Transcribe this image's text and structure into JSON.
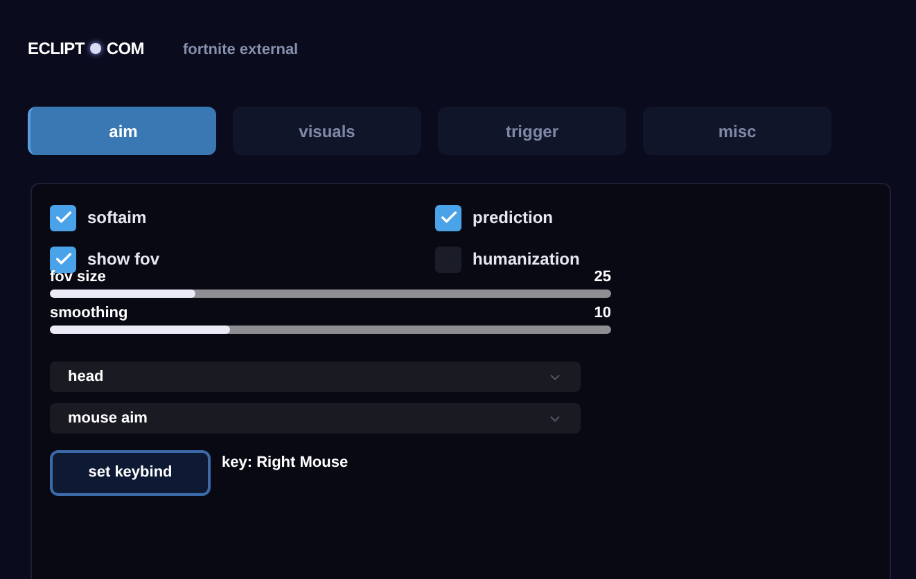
{
  "brand": {
    "left": "ECLIPT",
    "right": "COM"
  },
  "subtitle": "fortnite external",
  "tabs": [
    {
      "label": "aim",
      "selected": true
    },
    {
      "label": "visuals",
      "selected": false
    },
    {
      "label": "trigger",
      "selected": false
    },
    {
      "label": "misc",
      "selected": false
    }
  ],
  "checkboxes": [
    {
      "label": "softaim",
      "checked": true
    },
    {
      "label": "prediction",
      "checked": true
    },
    {
      "label": "show fov",
      "checked": true
    },
    {
      "label": "humanization",
      "checked": false
    }
  ],
  "sliders": [
    {
      "label": "fov size",
      "reading": "25",
      "level": 0.26
    },
    {
      "label": "smoothing",
      "reading": "10",
      "level": 0.32
    }
  ],
  "dropdowns": [
    {
      "value": "head"
    },
    {
      "value": "mouse aim"
    }
  ],
  "keybind": {
    "button": "set keybind",
    "key": "key: Right Mouse"
  }
}
